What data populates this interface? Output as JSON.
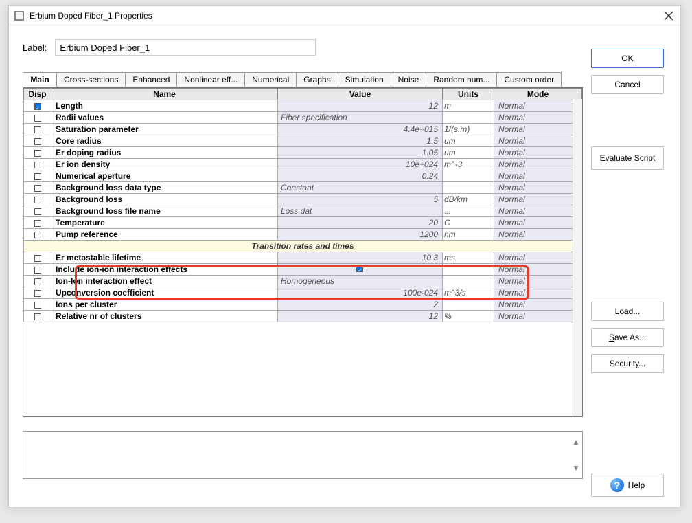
{
  "window": {
    "title": "Erbium Doped Fiber_1 Properties"
  },
  "label": {
    "caption": "Label:",
    "value": "Erbium Doped Fiber_1"
  },
  "tabs": [
    {
      "label": "Main",
      "active": true
    },
    {
      "label": "Cross-sections"
    },
    {
      "label": "Enhanced"
    },
    {
      "label": "Nonlinear eff..."
    },
    {
      "label": "Numerical"
    },
    {
      "label": "Graphs"
    },
    {
      "label": "Simulation"
    },
    {
      "label": "Noise"
    },
    {
      "label": "Random num..."
    },
    {
      "label": "Custom order"
    }
  ],
  "columns": {
    "disp": "Disp",
    "name": "Name",
    "value": "Value",
    "units": "Units",
    "mode": "Mode"
  },
  "sectionLabel": "Transition rates and times",
  "rows": [
    {
      "disp": true,
      "name": "Length",
      "value": "12",
      "align": "right",
      "units": "m",
      "mode": "Normal"
    },
    {
      "disp": false,
      "name": "Radii values",
      "value": "Fiber specification",
      "align": "left",
      "units": "",
      "mode": "Normal"
    },
    {
      "disp": false,
      "name": "Saturation parameter",
      "value": "4.4e+015",
      "align": "right",
      "units": "1/(s.m)",
      "mode": "Normal"
    },
    {
      "disp": false,
      "name": "Core radius",
      "value": "1.5",
      "align": "right",
      "units": "um",
      "mode": "Normal"
    },
    {
      "disp": false,
      "name": "Er doping radius",
      "value": "1.05",
      "align": "right",
      "units": "um",
      "mode": "Normal"
    },
    {
      "disp": false,
      "name": "Er ion density",
      "value": "10e+024",
      "align": "right",
      "units": "m^-3",
      "mode": "Normal"
    },
    {
      "disp": false,
      "name": "Numerical aperture",
      "value": "0.24",
      "align": "right",
      "units": "",
      "mode": "Normal"
    },
    {
      "disp": false,
      "name": "Background loss data type",
      "value": "Constant",
      "align": "left",
      "units": "",
      "mode": "Normal"
    },
    {
      "disp": false,
      "name": "Background loss",
      "value": "5",
      "align": "right",
      "units": "dB/km",
      "mode": "Normal"
    },
    {
      "disp": false,
      "name": "Background loss file name",
      "value": "Loss.dat",
      "align": "left",
      "units": "...",
      "mode": "Normal"
    },
    {
      "disp": false,
      "name": "Temperature",
      "value": "20",
      "align": "right",
      "units": "C",
      "mode": "Normal"
    },
    {
      "disp": false,
      "name": "Pump reference",
      "value": "1200",
      "align": "right",
      "units": "nm",
      "mode": "Normal"
    },
    {
      "section": true,
      "label": "Transition rates and times"
    },
    {
      "disp": false,
      "name": "Er metastable lifetime",
      "value": "10.3",
      "align": "right",
      "units": "ms",
      "mode": "Normal"
    },
    {
      "disp": false,
      "name": "Include ion-ion interaction effects",
      "value": "CHECK",
      "align": "center",
      "units": "",
      "mode": "Normal"
    },
    {
      "disp": false,
      "name": "Ion-Ion interaction effect",
      "value": "Homogeneous",
      "align": "left",
      "units": "",
      "mode": "Normal"
    },
    {
      "disp": false,
      "name": "Upconversion coefficient",
      "value": "100e-024",
      "align": "right",
      "units": "m^3/s",
      "mode": "Normal"
    },
    {
      "disp": false,
      "name": "Ions per cluster",
      "value": "2",
      "align": "right",
      "units": "",
      "mode": "Normal"
    },
    {
      "disp": false,
      "name": "Relative nr of clusters",
      "value": "12",
      "align": "right",
      "units": "%",
      "mode": "Normal"
    }
  ],
  "buttons": {
    "ok": "OK",
    "cancel": "Cancel",
    "evaluate": "Evaluate Script",
    "load": "Load...",
    "saveas": "Save As...",
    "security": "Security...",
    "help": "Help"
  }
}
